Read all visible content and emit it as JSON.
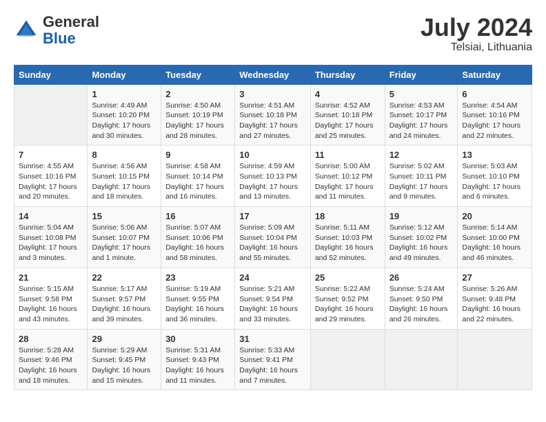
{
  "header": {
    "logo_general": "General",
    "logo_blue": "Blue",
    "month_year": "July 2024",
    "location": "Telsiai, Lithuania"
  },
  "columns": [
    "Sunday",
    "Monday",
    "Tuesday",
    "Wednesday",
    "Thursday",
    "Friday",
    "Saturday"
  ],
  "weeks": [
    [
      {
        "day": "",
        "info": ""
      },
      {
        "day": "1",
        "info": "Sunrise: 4:49 AM\nSunset: 10:20 PM\nDaylight: 17 hours\nand 30 minutes."
      },
      {
        "day": "2",
        "info": "Sunrise: 4:50 AM\nSunset: 10:19 PM\nDaylight: 17 hours\nand 28 minutes."
      },
      {
        "day": "3",
        "info": "Sunrise: 4:51 AM\nSunset: 10:18 PM\nDaylight: 17 hours\nand 27 minutes."
      },
      {
        "day": "4",
        "info": "Sunrise: 4:52 AM\nSunset: 10:18 PM\nDaylight: 17 hours\nand 25 minutes."
      },
      {
        "day": "5",
        "info": "Sunrise: 4:53 AM\nSunset: 10:17 PM\nDaylight: 17 hours\nand 24 minutes."
      },
      {
        "day": "6",
        "info": "Sunrise: 4:54 AM\nSunset: 10:16 PM\nDaylight: 17 hours\nand 22 minutes."
      }
    ],
    [
      {
        "day": "7",
        "info": "Sunrise: 4:55 AM\nSunset: 10:16 PM\nDaylight: 17 hours\nand 20 minutes."
      },
      {
        "day": "8",
        "info": "Sunrise: 4:56 AM\nSunset: 10:15 PM\nDaylight: 17 hours\nand 18 minutes."
      },
      {
        "day": "9",
        "info": "Sunrise: 4:58 AM\nSunset: 10:14 PM\nDaylight: 17 hours\nand 16 minutes."
      },
      {
        "day": "10",
        "info": "Sunrise: 4:59 AM\nSunset: 10:13 PM\nDaylight: 17 hours\nand 13 minutes."
      },
      {
        "day": "11",
        "info": "Sunrise: 5:00 AM\nSunset: 10:12 PM\nDaylight: 17 hours\nand 11 minutes."
      },
      {
        "day": "12",
        "info": "Sunrise: 5:02 AM\nSunset: 10:11 PM\nDaylight: 17 hours\nand 9 minutes."
      },
      {
        "day": "13",
        "info": "Sunrise: 5:03 AM\nSunset: 10:10 PM\nDaylight: 17 hours\nand 6 minutes."
      }
    ],
    [
      {
        "day": "14",
        "info": "Sunrise: 5:04 AM\nSunset: 10:08 PM\nDaylight: 17 hours\nand 3 minutes."
      },
      {
        "day": "15",
        "info": "Sunrise: 5:06 AM\nSunset: 10:07 PM\nDaylight: 17 hours\nand 1 minute."
      },
      {
        "day": "16",
        "info": "Sunrise: 5:07 AM\nSunset: 10:06 PM\nDaylight: 16 hours\nand 58 minutes."
      },
      {
        "day": "17",
        "info": "Sunrise: 5:09 AM\nSunset: 10:04 PM\nDaylight: 16 hours\nand 55 minutes."
      },
      {
        "day": "18",
        "info": "Sunrise: 5:11 AM\nSunset: 10:03 PM\nDaylight: 16 hours\nand 52 minutes."
      },
      {
        "day": "19",
        "info": "Sunrise: 5:12 AM\nSunset: 10:02 PM\nDaylight: 16 hours\nand 49 minutes."
      },
      {
        "day": "20",
        "info": "Sunrise: 5:14 AM\nSunset: 10:00 PM\nDaylight: 16 hours\nand 46 minutes."
      }
    ],
    [
      {
        "day": "21",
        "info": "Sunrise: 5:15 AM\nSunset: 9:58 PM\nDaylight: 16 hours\nand 43 minutes."
      },
      {
        "day": "22",
        "info": "Sunrise: 5:17 AM\nSunset: 9:57 PM\nDaylight: 16 hours\nand 39 minutes."
      },
      {
        "day": "23",
        "info": "Sunrise: 5:19 AM\nSunset: 9:55 PM\nDaylight: 16 hours\nand 36 minutes."
      },
      {
        "day": "24",
        "info": "Sunrise: 5:21 AM\nSunset: 9:54 PM\nDaylight: 16 hours\nand 33 minutes."
      },
      {
        "day": "25",
        "info": "Sunrise: 5:22 AM\nSunset: 9:52 PM\nDaylight: 16 hours\nand 29 minutes."
      },
      {
        "day": "26",
        "info": "Sunrise: 5:24 AM\nSunset: 9:50 PM\nDaylight: 16 hours\nand 26 minutes."
      },
      {
        "day": "27",
        "info": "Sunrise: 5:26 AM\nSunset: 9:48 PM\nDaylight: 16 hours\nand 22 minutes."
      }
    ],
    [
      {
        "day": "28",
        "info": "Sunrise: 5:28 AM\nSunset: 9:46 PM\nDaylight: 16 hours\nand 18 minutes."
      },
      {
        "day": "29",
        "info": "Sunrise: 5:29 AM\nSunset: 9:45 PM\nDaylight: 16 hours\nand 15 minutes."
      },
      {
        "day": "30",
        "info": "Sunrise: 5:31 AM\nSunset: 9:43 PM\nDaylight: 16 hours\nand 11 minutes."
      },
      {
        "day": "31",
        "info": "Sunrise: 5:33 AM\nSunset: 9:41 PM\nDaylight: 16 hours\nand 7 minutes."
      },
      {
        "day": "",
        "info": ""
      },
      {
        "day": "",
        "info": ""
      },
      {
        "day": "",
        "info": ""
      }
    ]
  ]
}
